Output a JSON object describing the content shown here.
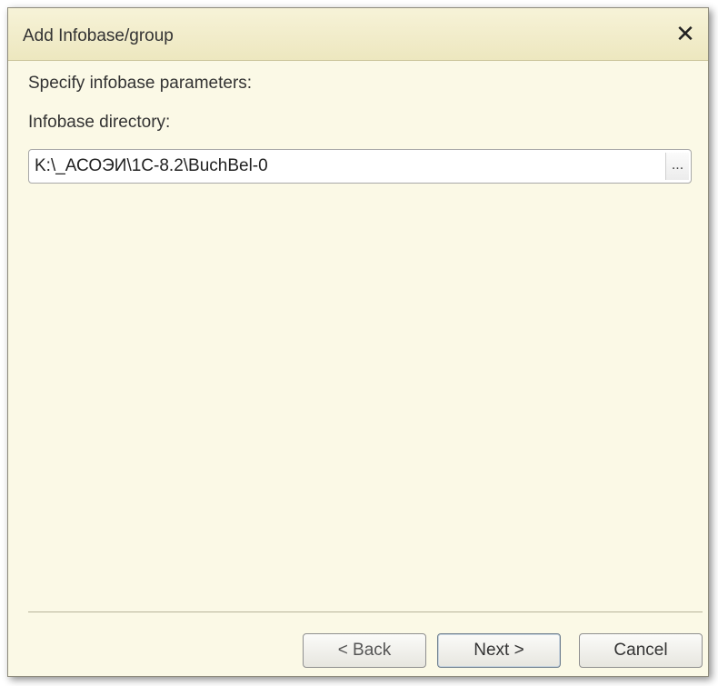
{
  "window": {
    "title": "Add Infobase/group",
    "close_symbol": "✕"
  },
  "content": {
    "instruction": "Specify infobase parameters:",
    "directory_label": "Infobase directory:",
    "directory_value": "K:\\_АСОЭИ\\1С-8.2\\BuchBel-0",
    "browse_label": "..."
  },
  "buttons": {
    "back": "< Back",
    "next": "Next >",
    "cancel": "Cancel"
  },
  "colors": {
    "background": "#fbf9e6",
    "titlebar": "#ede7bf"
  }
}
